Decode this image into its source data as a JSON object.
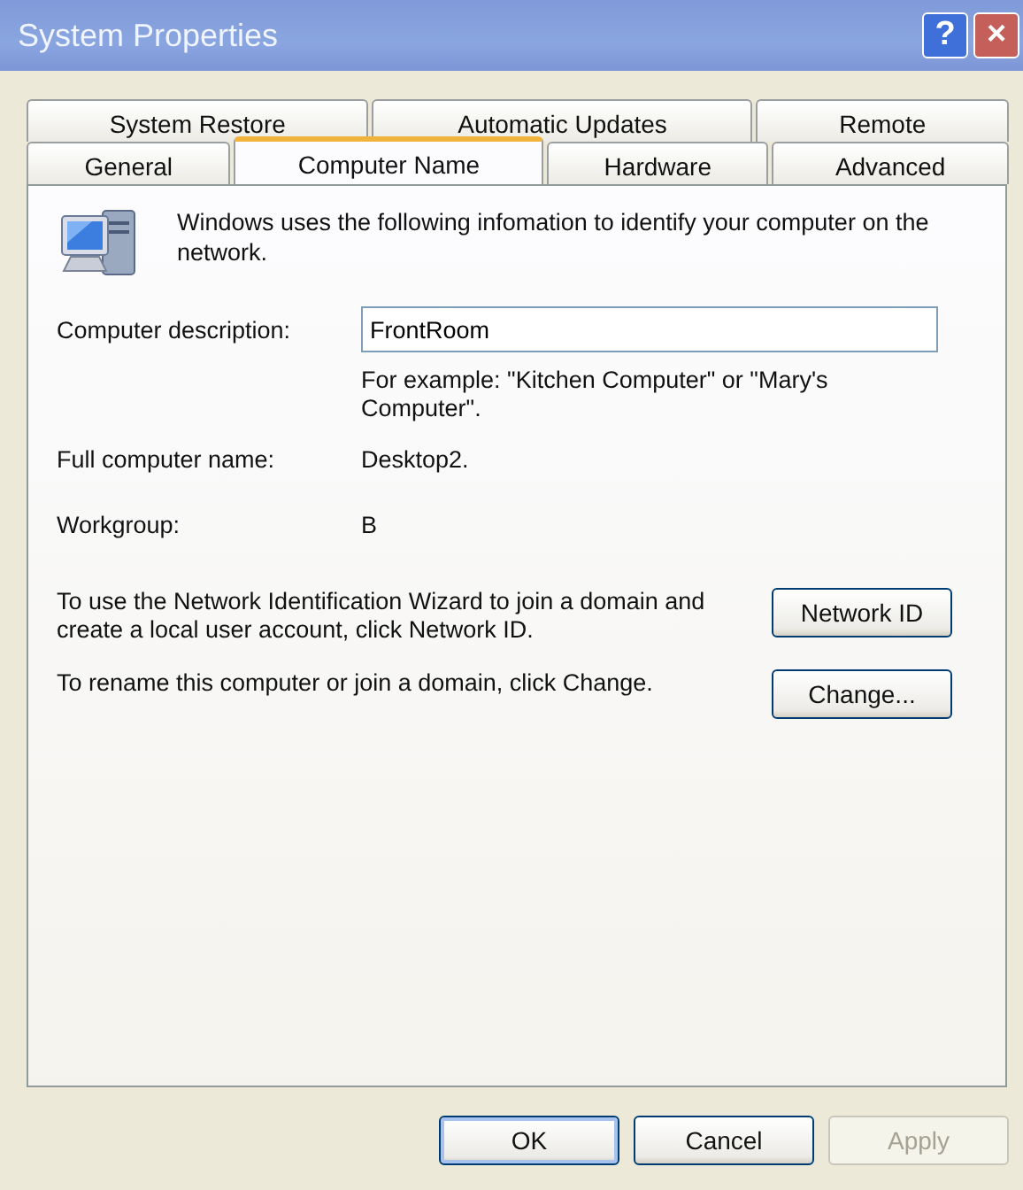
{
  "window": {
    "title": "System Properties",
    "help_button": "?",
    "close_button": "×"
  },
  "tab_rows": [
    [
      {
        "label": "System Restore",
        "selected": false
      },
      {
        "label": "Automatic Updates",
        "selected": false
      },
      {
        "label": "Remote",
        "selected": false
      }
    ],
    [
      {
        "label": "General",
        "selected": false
      },
      {
        "label": "Computer Name",
        "selected": true
      },
      {
        "label": "Hardware",
        "selected": false
      },
      {
        "label": "Advanced",
        "selected": false
      }
    ]
  ],
  "intro": "Windows uses the following infomation to identify your computer on the network.",
  "description": {
    "label": "Computer description:",
    "value": "FrontRoom",
    "hint": "For example: \"Kitchen Computer\" or \"Mary's Computer\"."
  },
  "fields": [
    {
      "label": "Full computer name:",
      "value": "Desktop2."
    },
    {
      "label": "Workgroup:",
      "value": "B"
    }
  ],
  "actions": [
    {
      "text": "To use the Network Identification Wizard to join a domain and create a local user account, click Network ID.",
      "button": "Network ID"
    },
    {
      "text": "To rename this computer or join a domain, click Change.",
      "button": "Change..."
    }
  ],
  "buttons": [
    {
      "label": "OK",
      "disabled": false,
      "default": true
    },
    {
      "label": "Cancel",
      "disabled": false,
      "default": false
    },
    {
      "label": "Apply",
      "disabled": true,
      "default": false
    }
  ]
}
